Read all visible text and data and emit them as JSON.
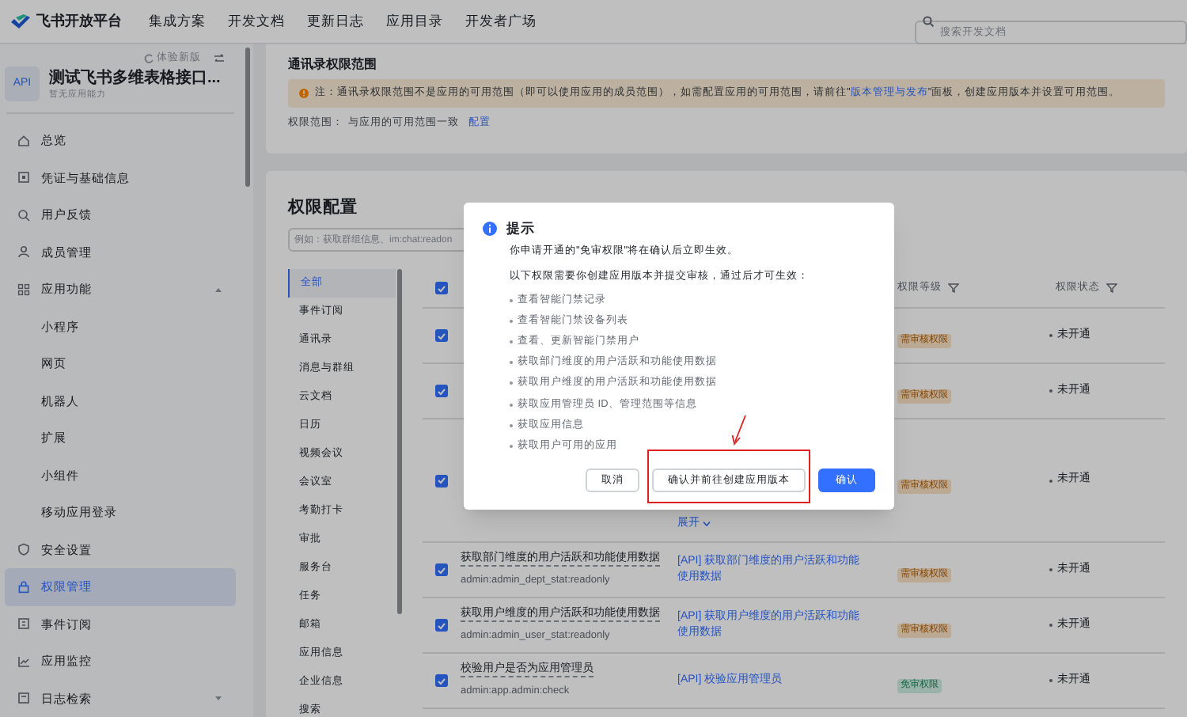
{
  "header": {
    "logo": "飞书开放平台",
    "nav": [
      "集成方案",
      "开发文档",
      "更新日志",
      "应用目录",
      "开发者广场"
    ],
    "search": {
      "placeholder": "搜索开发文档"
    }
  },
  "sidebar": {
    "new_version": "体验新版",
    "app": {
      "icon": "API",
      "name": "测试飞书多维表格接口...",
      "subtitle": "暂无应用能力"
    },
    "items": [
      {
        "label": "总览",
        "selected": false
      },
      {
        "label": "凭证与基础信息",
        "selected": false
      },
      {
        "label": "用户反馈",
        "selected": false
      },
      {
        "label": "成员管理",
        "selected": false
      },
      {
        "label": "应用功能",
        "selected": false,
        "expanded": true,
        "children": [
          {
            "label": "小程序",
            "selected": false
          },
          {
            "label": "网页",
            "selected": false
          },
          {
            "label": "机器人",
            "selected": false
          },
          {
            "label": "扩展",
            "selected": false
          },
          {
            "label": "小组件",
            "selected": false
          },
          {
            "label": "移动应用登录",
            "selected": false
          }
        ]
      },
      {
        "label": "安全设置",
        "selected": false
      },
      {
        "label": "权限管理",
        "selected": true
      },
      {
        "label": "事件订阅",
        "selected": false
      },
      {
        "label": "应用监控",
        "selected": false
      },
      {
        "label": "日志检索",
        "selected": false,
        "expanded": false
      }
    ]
  },
  "scope_card": {
    "title": "通讯录权限范围",
    "notice": {
      "before": "注：通讯录权限范围不是应用的可用范围（即可以使用应用的成员范围），如需配置应用的可用范围，请前往\"",
      "link": "版本管理与发布",
      "after": "\"面板，创建应用版本并设置可用范围。"
    },
    "scope_label": "权限范围：",
    "scope_value": "与应用的可用范围一致",
    "configure_link": "配置"
  },
  "permissions": {
    "title": "权限配置",
    "search": {
      "placeholder": "例如：获取群组信息、im:chat:readon"
    },
    "categories": [
      {
        "label": "全部",
        "selected": true
      },
      {
        "label": "事件订阅",
        "selected": false
      },
      {
        "label": "通讯录",
        "selected": false
      },
      {
        "label": "消息与群组",
        "selected": false
      },
      {
        "label": "云文档",
        "selected": false
      },
      {
        "label": "日历",
        "selected": false
      },
      {
        "label": "视频会议",
        "selected": false
      },
      {
        "label": "会议室",
        "selected": false
      },
      {
        "label": "考勤打卡",
        "selected": false
      },
      {
        "label": "审批",
        "selected": false
      },
      {
        "label": "服务台",
        "selected": false
      },
      {
        "label": "任务",
        "selected": false
      },
      {
        "label": "邮箱",
        "selected": false
      },
      {
        "label": "应用信息",
        "selected": false
      },
      {
        "label": "企业信息",
        "selected": false
      },
      {
        "label": "搜索",
        "selected": false
      }
    ],
    "table": {
      "header_checked": true,
      "columns": {
        "level": "权限等级",
        "status": "权限状态"
      },
      "rows": [
        {
          "checked": true,
          "level": {
            "label": "需审核权限",
            "kind": "review"
          },
          "status": "未开通"
        },
        {
          "checked": true,
          "level": {
            "label": "需审核权限",
            "kind": "review"
          },
          "status": "未开通"
        },
        {
          "checked": true,
          "expand": "展开",
          "level": {
            "label": "需审核权限",
            "kind": "review"
          },
          "status": "未开通"
        },
        {
          "checked": true,
          "name": "获取部门维度的用户活跃和功能使用数据",
          "code": "admin:admin_dept_stat:readonly",
          "api": "[API] 获取部门维度的用户活跃和功能使用数据",
          "level": {
            "label": "需审核权限",
            "kind": "review"
          },
          "status": "未开通"
        },
        {
          "checked": true,
          "name": "获取用户维度的用户活跃和功能使用数据",
          "code": "admin:admin_user_stat:readonly",
          "api": "[API] 获取用户维度的用户活跃和功能使用数据",
          "level": {
            "label": "需审核权限",
            "kind": "review"
          },
          "status": "未开通"
        },
        {
          "checked": true,
          "name": "校验用户是否为应用管理员",
          "code": "admin:app.admin:check",
          "api": "[API] 校验应用管理员",
          "level": {
            "label": "免审权限",
            "kind": "free"
          },
          "status": "未开通"
        }
      ]
    }
  },
  "dialog": {
    "title": "提示",
    "message": "你申请开通的\"免审权限\"将在确认后立即生效。",
    "intro": "以下权限需要你创建应用版本并提交审核，通过后才可生效：",
    "items": [
      "查看智能门禁记录",
      "查看智能门禁设备列表",
      "查看、更新智能门禁用户",
      "获取部门维度的用户活跃和功能使用数据",
      "获取用户维度的用户活跃和功能使用数据",
      "获取应用管理员 ID、管理范围等信息",
      "获取应用信息",
      "获取用户可用的应用"
    ],
    "buttons": [
      {
        "label": "取消",
        "kind": "default"
      },
      {
        "label": "确认并前往创建应用版本",
        "kind": "default",
        "highlighted": true
      },
      {
        "label": "确认",
        "kind": "primary"
      }
    ]
  }
}
